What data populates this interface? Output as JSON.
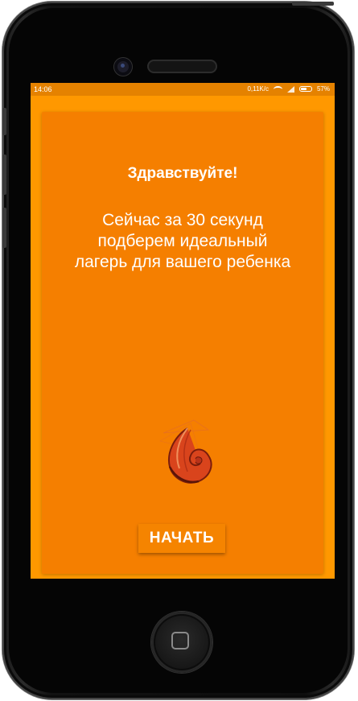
{
  "status_bar": {
    "time": "14:06",
    "network_speed": "0,11K/c",
    "battery_percent": "57%"
  },
  "onboarding": {
    "greeting": "Здравствуйте!",
    "message": "Сейчас за 30 секунд подберем идеальный лагерь для вашего ребенка",
    "start_button": "НАЧАТЬ"
  },
  "colors": {
    "screen_background": "#ff9800",
    "card_background": "#f57f00",
    "status_bar": "#e58200",
    "text": "#ffffff"
  },
  "icons": {
    "logo": "shell-logo",
    "status": [
      "wifi-icon",
      "signal-icon",
      "battery-icon"
    ]
  }
}
